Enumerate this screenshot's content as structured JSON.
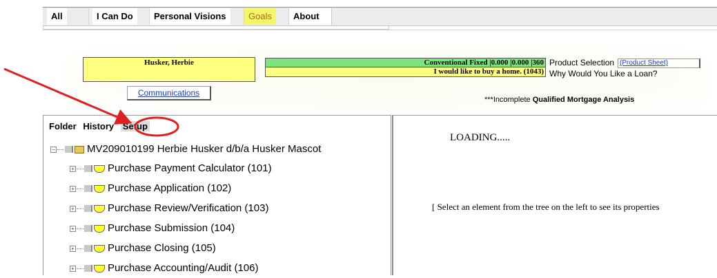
{
  "top_tabs": [
    {
      "label": "All"
    },
    {
      "label": "I Can Do"
    },
    {
      "label": "Personal Visions"
    },
    {
      "label": "Goals",
      "active": true
    },
    {
      "label": "About"
    }
  ],
  "header": {
    "borrower_name": "Husker, Herbie",
    "communications_label": "Communications",
    "product_value": "Conventional Fixed    |0.000 |0.000 |360",
    "product_label": "Product Selection",
    "product_sheet_link": "(Product Sheet)",
    "goal_value": "I would like to buy a home. (1043)",
    "goal_label": "Why Would You Like a Loan?",
    "qm_prefix": "***Incomplete",
    "qm_bold": "Qualified Mortgage Analysis"
  },
  "folder_tabs": {
    "folder": "Folder",
    "history": "History",
    "setup": "Setup"
  },
  "tree": {
    "root": "MV209010199 Herbie Husker d/b/a Husker Mascot",
    "nodes": [
      {
        "label": "Purchase Payment Calculator (101)"
      },
      {
        "label": "Purchase Application (102)"
      },
      {
        "label": "Purchase Review/Verification (103)"
      },
      {
        "label": "Purchase Submission (104)"
      },
      {
        "label": "Purchase Closing (105)"
      },
      {
        "label": "Purchase Accounting/Audit (106)"
      }
    ]
  },
  "content": {
    "loading": "LOADING.....",
    "select_message": "[  Select an element from the tree on the left to see its properties"
  },
  "colors": {
    "goals_tab": "#f5f56a",
    "yellow_box": "#ffff80",
    "green_box": "#7de37d",
    "annotation_red": "#e02020"
  }
}
